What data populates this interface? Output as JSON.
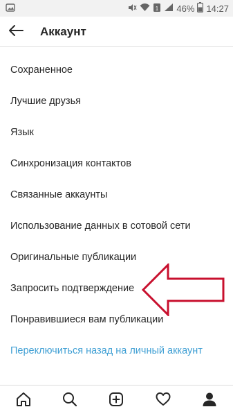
{
  "status_bar": {
    "battery_percent": "46%",
    "time": "14:27",
    "icons": [
      "photo-icon",
      "mute-icon",
      "wifi-icon",
      "sim-icon",
      "signal-icon",
      "battery-icon"
    ]
  },
  "header": {
    "back_icon": "back-arrow-icon",
    "title": "Аккаунт"
  },
  "menu": {
    "items": [
      {
        "label": "Сохраненное"
      },
      {
        "label": "Лучшие друзья"
      },
      {
        "label": "Язык"
      },
      {
        "label": "Синхронизация контактов"
      },
      {
        "label": "Связанные аккаунты"
      },
      {
        "label": "Использование данных в сотовой сети"
      },
      {
        "label": "Оригинальные публикации"
      },
      {
        "label": "Запросить подтверждение"
      },
      {
        "label": "Понравившиеся вам публикации"
      }
    ],
    "switch_link": "Переключиться назад на личный аккаунт"
  },
  "annotation": {
    "arrow_color": "#c8102e"
  },
  "tabbar": {
    "tabs": [
      "home-icon",
      "search-icon",
      "add-post-icon",
      "activity-heart-icon",
      "profile-icon"
    ]
  },
  "colors": {
    "link": "#3f9fd4",
    "text": "#262626",
    "status_bar": "#f2f2f2"
  }
}
